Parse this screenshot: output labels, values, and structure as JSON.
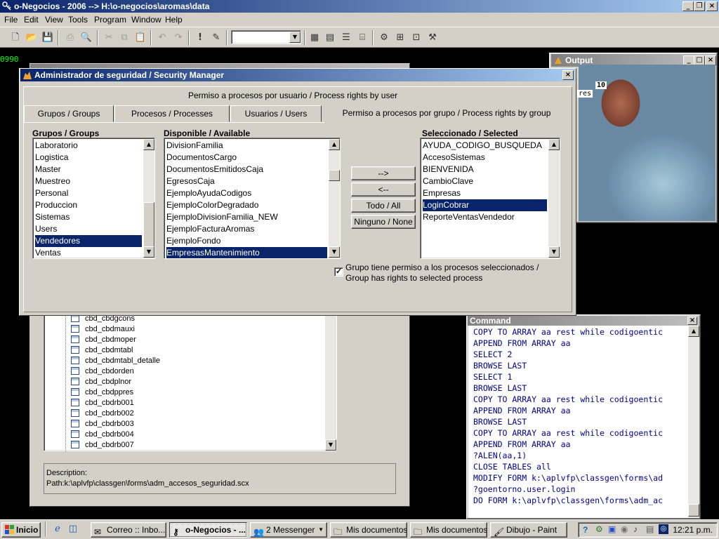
{
  "app": {
    "title": "o-Negocios - 2006 --> H:\\o-negocios\\aromas\\data",
    "menu": [
      "File",
      "Edit",
      "View",
      "Tools",
      "Program",
      "Window",
      "Help"
    ],
    "side_counter": "0990"
  },
  "output_window": {
    "title": "Output",
    "label_number": "10",
    "label_text": "res"
  },
  "security_dialog": {
    "title": "Administrador de seguridad / Security Manager",
    "heading": "Permiso a procesos por usuario / Process rights by user",
    "tabs": [
      {
        "label": "Grupos / Groups"
      },
      {
        "label": "Procesos / Processes"
      },
      {
        "label": "Usuarios / Users"
      },
      {
        "label": "Permiso a procesos por  grupo / Process rights by group"
      }
    ],
    "groups_header": "Grupos / Groups",
    "groups": [
      "Laboratorio",
      "Logistica",
      "Master",
      "Muestreo",
      "Personal",
      "Produccion",
      "Sistemas",
      "Users",
      "Vendedores",
      "Ventas"
    ],
    "groups_selected": "Vendedores",
    "available_header": "Disponible / Available",
    "available": [
      "DivisionFamilia",
      "DocumentosCargo",
      "DocumentosEmitidosCaja",
      "EgresosCaja",
      "EjemploAyudaCodigos",
      "EjemploColorDegradado",
      "EjemploDivisionFamilia_NEW",
      "EjemploFacturaAromas",
      "EjemploFondo",
      "EmpresasMantenimiento"
    ],
    "available_selected": "EmpresasMantenimiento",
    "selected_header": "Seleccionado / Selected",
    "selected": [
      "AYUDA_CODIGO_BUSQUEDA",
      "AccesoSistemas",
      "BIENVENIDA",
      "CambioClave",
      "Empresas",
      "LoginCobrar",
      "ReporteVentasVendedor"
    ],
    "selected_highlight": "LoginCobrar",
    "buttons": {
      "add": "-->",
      "remove": "<--",
      "all": "Todo / All",
      "none": "Ninguno / None"
    },
    "checkbox_label": "Grupo tiene permiso a los procesos seleccionados / Group has rights to selected process",
    "checkbox_checked": true
  },
  "project_tree": {
    "items": [
      "cbd_cbdgcons",
      "cbd_cbdmauxi",
      "cbd_cbdmoper",
      "cbd_cbdmtabl",
      "cbd_cbdmtabl_detalle",
      "cbd_cbdorden",
      "cbd_cbdplnor",
      "cbd_cbdppres",
      "cbd_cbdrb001",
      "cbd_cbdrb002",
      "cbd_cbdrb003",
      "cbd_cbdrb004",
      "cbd_cbdrb007"
    ],
    "description_label": "Description:",
    "description_path": "Path:k:\\aplvfp\\classgen\\forms\\adm_accesos_seguridad.scx"
  },
  "command_window": {
    "title": "Command",
    "lines": [
      "COPY TO ARRAY aa rest while codigoentic",
      "APPEND FROM ARRAY aa",
      "SELECT 2",
      "BROWSE LAST",
      "SELECT 1",
      "BROWSE LAST",
      "COPY TO ARRAY aa rest while codigoentic",
      "APPEND FROM ARRAY aa",
      "BROWSE LAST",
      "COPY TO ARRAY aa rest while codigoentic",
      "APPEND FROM ARRAY aa",
      "?ALEN(aa,1)",
      "CLOSE TABLES all",
      "MODIFY FORM k:\\aplvfp\\classgen\\forms\\ad",
      "?goentorno.user.login",
      "DO FORM k:\\aplvfp\\classgen\\forms\\adm_ac"
    ]
  },
  "taskbar": {
    "start": "Inicio",
    "tasks": [
      "Correo :: Inbo...",
      "o-Negocios - ...",
      "2 Messenger",
      "Mis documentos",
      "Mis documentos",
      "Dibujo - Paint"
    ],
    "clock": "12:21 p.m."
  },
  "colors": {
    "titlebar_active": "#0a246a",
    "selection": "#0a246a",
    "face": "#d4d0c8"
  }
}
